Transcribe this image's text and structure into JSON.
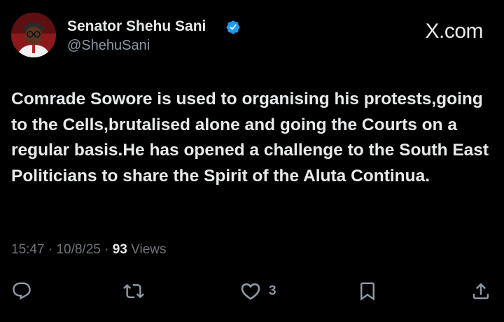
{
  "author": {
    "display_name": "Senator Shehu Sani",
    "handle": "@ShehuSani",
    "verified": true
  },
  "brand": {
    "label": "X.com",
    "icon": "x-logo-icon"
  },
  "tweet": {
    "text": "Comrade Sowore is used to organising his protests,going to the Cells,brutalised alone and going the Courts on a regular basis.He has opened a challenge to the South East Politicians to share the Spirit of the Aluta Continua."
  },
  "meta": {
    "time": "15:47",
    "date": "10/8/25",
    "views_count": "93",
    "views_label": "Views",
    "separator": "·"
  },
  "actions": {
    "reply": {
      "icon": "reply-icon"
    },
    "retweet": {
      "icon": "retweet-icon"
    },
    "like": {
      "icon": "heart-icon",
      "count": "3"
    },
    "bookmark": {
      "icon": "bookmark-icon"
    },
    "share": {
      "icon": "share-icon"
    }
  },
  "colors": {
    "background": "#000000",
    "text_primary": "#e7e9ea",
    "text_secondary": "#71767b",
    "verified_blue": "#1d9bf0"
  }
}
